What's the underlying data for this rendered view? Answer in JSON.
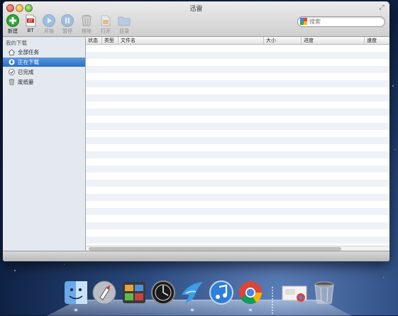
{
  "window": {
    "title": "迅雷"
  },
  "toolbar": {
    "new_label": "新建",
    "bt_label": "BT",
    "start_label": "开始",
    "pause_label": "暂停",
    "remove_label": "移除",
    "open_label": "打开",
    "folder_label": "目录"
  },
  "search": {
    "placeholder": "搜索"
  },
  "sidebar": {
    "header": "我的下载",
    "items": [
      {
        "label": "全部任务",
        "icon": "home-icon"
      },
      {
        "label": "正在下载",
        "icon": "download-icon",
        "selected": true
      },
      {
        "label": "已完成",
        "icon": "check-icon"
      },
      {
        "label": "废纸篓",
        "icon": "trash-icon"
      }
    ]
  },
  "columns": [
    {
      "label": "状态"
    },
    {
      "label": "类型"
    },
    {
      "label": "文件名"
    },
    {
      "label": "大小"
    },
    {
      "label": "进度"
    },
    {
      "label": "速度"
    }
  ],
  "dock": {
    "apps": [
      "finder-icon",
      "launchpad-icon",
      "photo-booth-icon",
      "dashboard-icon",
      "xunlei-icon",
      "itunes-icon",
      "chrome-icon",
      "downloads-stack-icon",
      "trash-icon"
    ]
  },
  "colors": {
    "selection": "#2a6fc4",
    "row_alt": "#eef2f8"
  }
}
